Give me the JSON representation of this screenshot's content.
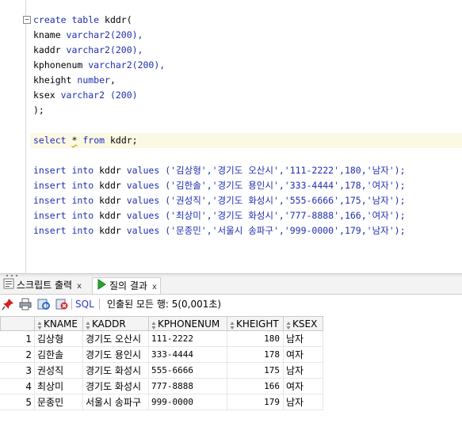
{
  "editor": {
    "fold_icon": "minus-box-icon",
    "lines": [
      {
        "parts": [
          {
            "t": "create table ",
            "c": "kw"
          },
          {
            "t": "kddr(",
            "c": ""
          }
        ]
      },
      {
        "parts": [
          {
            "t": "kname ",
            "c": ""
          },
          {
            "t": "varchar2",
            "c": "kw"
          },
          {
            "t": "(200),",
            "c": "num"
          }
        ]
      },
      {
        "parts": [
          {
            "t": "kaddr ",
            "c": ""
          },
          {
            "t": "varchar2",
            "c": "kw"
          },
          {
            "t": "(200),",
            "c": "num"
          }
        ]
      },
      {
        "parts": [
          {
            "t": "kphonenum ",
            "c": ""
          },
          {
            "t": "varchar2",
            "c": "kw"
          },
          {
            "t": "(200),",
            "c": "num"
          }
        ]
      },
      {
        "parts": [
          {
            "t": "kheight ",
            "c": ""
          },
          {
            "t": "number",
            "c": "kw"
          },
          {
            "t": ",",
            "c": ""
          }
        ]
      },
      {
        "parts": [
          {
            "t": "ksex ",
            "c": ""
          },
          {
            "t": "varchar2 ",
            "c": "kw"
          },
          {
            "t": "(200)",
            "c": "num"
          }
        ]
      },
      {
        "parts": [
          {
            "t": ");",
            "c": ""
          }
        ]
      },
      {
        "parts": []
      },
      {
        "parts": [
          {
            "t": "select ",
            "c": "kw"
          },
          {
            "t": "*",
            "c": "sq"
          },
          {
            "t": " ",
            "c": ""
          },
          {
            "t": "from ",
            "c": "kw"
          },
          {
            "t": "kddr;",
            "c": ""
          }
        ],
        "highlight": true
      },
      {
        "parts": []
      },
      {
        "parts": [
          {
            "t": "insert into ",
            "c": "kw"
          },
          {
            "t": "kddr ",
            "c": ""
          },
          {
            "t": "values ",
            "c": "kw"
          },
          {
            "t": "('김상형','경기도 오산시','111-2222',180,'남자');",
            "c": "str"
          }
        ]
      },
      {
        "parts": [
          {
            "t": "insert into ",
            "c": "kw"
          },
          {
            "t": "kddr ",
            "c": ""
          },
          {
            "t": "values ",
            "c": "kw"
          },
          {
            "t": "('김한솔','경기도 용인시','333-4444',178,'여자');",
            "c": "str"
          }
        ]
      },
      {
        "parts": [
          {
            "t": "insert into ",
            "c": "kw"
          },
          {
            "t": "kddr ",
            "c": ""
          },
          {
            "t": "values ",
            "c": "kw"
          },
          {
            "t": "('권성직','경기도 화성시','555-6666',175,'남자');",
            "c": "str"
          }
        ]
      },
      {
        "parts": [
          {
            "t": "insert into ",
            "c": "kw"
          },
          {
            "t": "kddr ",
            "c": ""
          },
          {
            "t": "values ",
            "c": "kw"
          },
          {
            "t": "('최상미','경기도 화성시','777-8888',166,'여자');",
            "c": "str"
          }
        ]
      },
      {
        "parts": [
          {
            "t": "insert into ",
            "c": "kw"
          },
          {
            "t": "kddr ",
            "c": ""
          },
          {
            "t": "values ",
            "c": "kw"
          },
          {
            "t": "('문종민','서울시 송파구','999-0000',179,'남자');",
            "c": "str"
          }
        ]
      }
    ]
  },
  "tabs": [
    {
      "label": "스크립트 출력",
      "icon": "script-output-icon",
      "close": "x"
    },
    {
      "label": "질의 결과",
      "icon": "run-query-icon",
      "close": "x"
    }
  ],
  "toolbar": {
    "sql_label": "SQL",
    "status": "인출된 모든 행: 5(0,001초)",
    "icons": [
      "pin-icon",
      "print-icon",
      "refresh-icon",
      "cancel-icon"
    ]
  },
  "grid": {
    "columns": [
      "KNAME",
      "KADDR",
      "KPHONENUM",
      "KHEIGHT",
      "KSEX"
    ],
    "rows": [
      {
        "n": "1",
        "kname": "김상형",
        "kaddr": "경기도 오산시",
        "kphone": "111-2222",
        "kheight": "180",
        "ksex": "남자"
      },
      {
        "n": "2",
        "kname": "김한솔",
        "kaddr": "경기도 용인시",
        "kphone": "333-4444",
        "kheight": "178",
        "ksex": "여자"
      },
      {
        "n": "3",
        "kname": "권성직",
        "kaddr": "경기도 화성시",
        "kphone": "555-6666",
        "kheight": "175",
        "ksex": "남자"
      },
      {
        "n": "4",
        "kname": "최상미",
        "kaddr": "경기도 화성시",
        "kphone": "777-8888",
        "kheight": "166",
        "ksex": "여자"
      },
      {
        "n": "5",
        "kname": "문종민",
        "kaddr": "서울시 송파구",
        "kphone": "999-0000",
        "kheight": "179",
        "ksex": "남자"
      }
    ]
  }
}
